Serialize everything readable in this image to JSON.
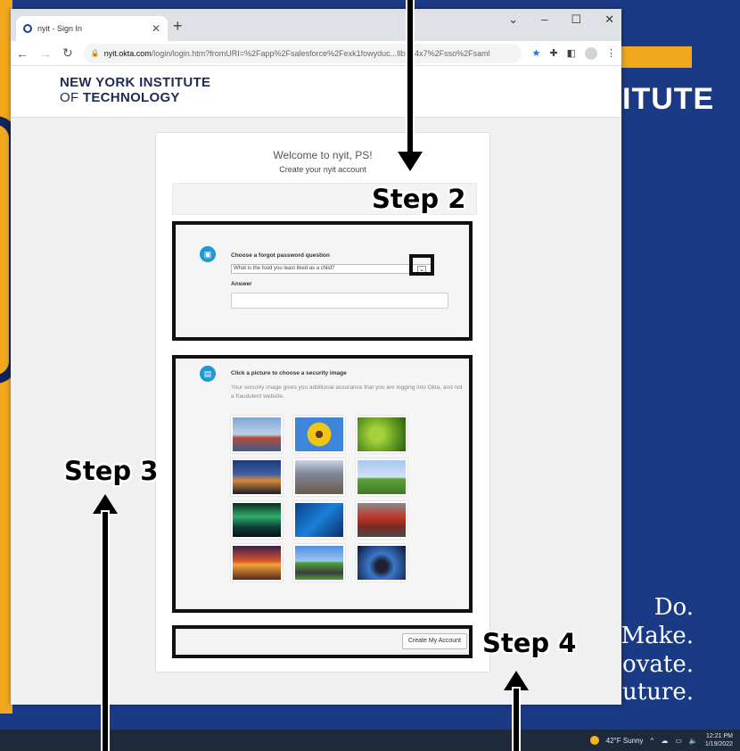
{
  "desktop": {
    "brand_word": "ITUTE",
    "slogan": [
      "Do.",
      "Make.",
      "ovate.",
      "uture."
    ]
  },
  "taskbar": {
    "weather": "42°F  Sunny",
    "time": "12:21 PM",
    "date": "1/19/2022"
  },
  "browser": {
    "tab_title": "nyit - Sign In",
    "url_host": "nyit.okta.com",
    "url_path": "/login/login.htm?fromURI=%2Fapp%2Fsalesforce%2Fexk1fowyduc...IlbcY4x7%2Fsso%2Fsaml"
  },
  "page": {
    "logo_line1": "NEW YORK INSTITUTE",
    "logo_line2_prefix": "OF ",
    "logo_line2_main": "TECHNOLOGY",
    "welcome": "Welcome to nyit, PS!",
    "subtitle": "Create your nyit account",
    "forgot_question_label": "Choose a forgot password question",
    "forgot_question_value": "What is the food you least liked as a child?",
    "answer_label": "Answer",
    "security_image_title": "Click a picture to choose a security image",
    "security_image_desc": "Your security image gives you additional assurance that you are logging into Okta, and not a fraudulent website.",
    "create_button": "Create My Account",
    "images": [
      "golden-gate-bridge",
      "sunflower",
      "green-leaf",
      "bridge-at-night",
      "brooklyn-bridge",
      "sheep-on-grass",
      "aurora",
      "circuit-board",
      "red-toaster",
      "sunset-clouds",
      "open-road",
      "stingray"
    ]
  },
  "annotations": {
    "step2": "Step 2",
    "step3": "Step 3",
    "step4": "Step 4"
  }
}
